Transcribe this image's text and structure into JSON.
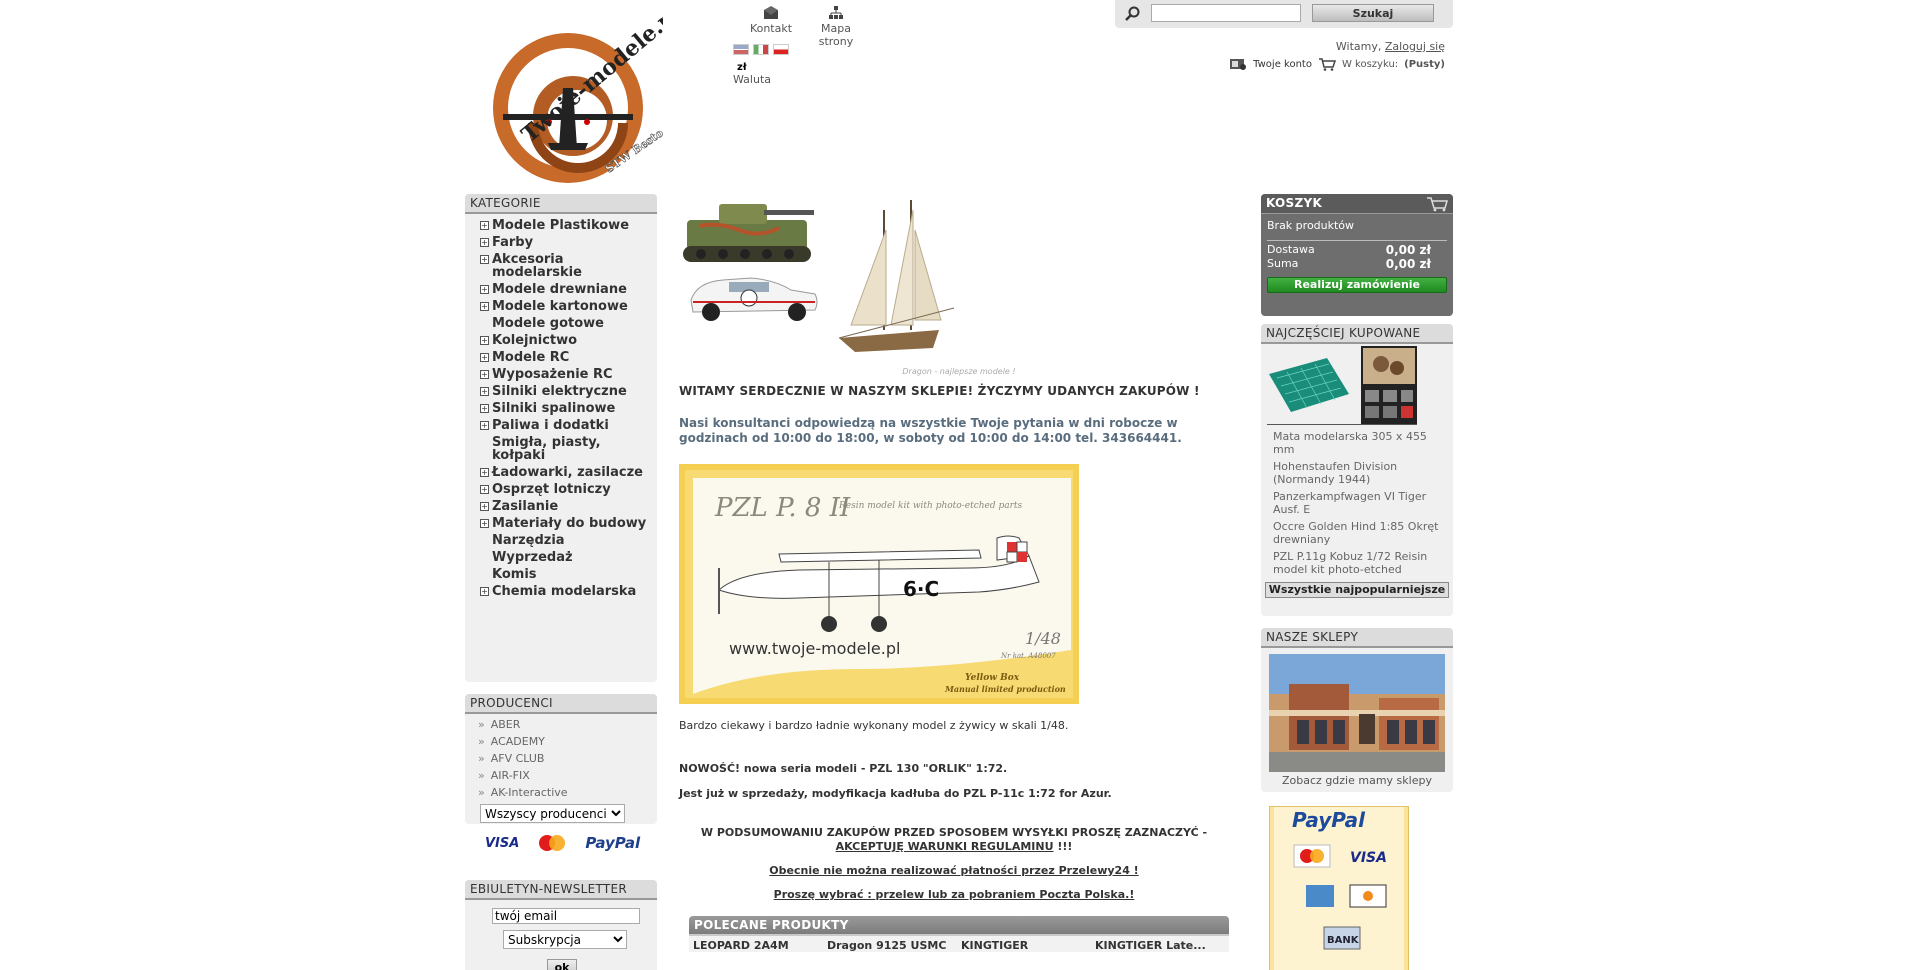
{
  "header": {
    "top_links": {
      "contact": "Kontakt",
      "sitemap": "Mapa strony"
    },
    "currency": {
      "symbol": "zł",
      "label": "Waluta"
    },
    "search": {
      "placeholder": "",
      "button": "Szukaj"
    },
    "welcome": {
      "text": "Witamy,",
      "login": "Zaloguj się"
    },
    "account": {
      "my_account": "Twoje konto",
      "cart_label": "W koszyku:",
      "cart_value": "(Pusty)"
    }
  },
  "categories": {
    "title": "KATEGORIE",
    "items": [
      {
        "label": "Modele Plastikowe",
        "expandable": true
      },
      {
        "label": "Farby",
        "expandable": true
      },
      {
        "label": "Akcesoria modelarskie",
        "expandable": true
      },
      {
        "label": "Modele drewniane",
        "expandable": true
      },
      {
        "label": "Modele kartonowe",
        "expandable": true
      },
      {
        "label": "Modele gotowe",
        "expandable": false
      },
      {
        "label": "Kolejnictwo",
        "expandable": true
      },
      {
        "label": "Modele RC",
        "expandable": true
      },
      {
        "label": "Wyposażenie RC",
        "expandable": true
      },
      {
        "label": "Silniki elektryczne",
        "expandable": true
      },
      {
        "label": "Silniki spalinowe",
        "expandable": true
      },
      {
        "label": "Paliwa i dodatki",
        "expandable": true
      },
      {
        "label": "Smigła, piasty, kołpaki",
        "expandable": false
      },
      {
        "label": "Ładowarki, zasilacze",
        "expandable": true
      },
      {
        "label": "Osprzęt lotniczy",
        "expandable": true
      },
      {
        "label": "Zasilanie",
        "expandable": true
      },
      {
        "label": "Materiały do budowy",
        "expandable": true
      },
      {
        "label": "Narzędzia",
        "expandable": false
      },
      {
        "label": "Wyprzedaż",
        "expandable": false
      },
      {
        "label": "Komis",
        "expandable": false
      },
      {
        "label": "Chemia modelarska",
        "expandable": true
      }
    ]
  },
  "producers": {
    "title": "PRODUCENCI",
    "items": [
      "ABER",
      "ACADEMY",
      "AFV CLUB",
      "AIR-FIX",
      "AK-Interactive"
    ],
    "select_value": "Wszyscy producenci"
  },
  "payment_logos": [
    "VISA",
    "MasterCard",
    "PayPal"
  ],
  "newsletter": {
    "title": "EBIULETYN-NEWSLETTER",
    "email_value": "twój email",
    "select_value": "Subskrypcja",
    "ok": "ok"
  },
  "center": {
    "banner_caption": "Dragon - najlepsze modele !",
    "welcome": "WITAMY SERDECZNIE W NASZYM SKLEPIE! ŻYCZYMY UDANYCH ZAKUPÓW !",
    "consultants": "Nasi konsultanci odpowiedzą na wszystkie Twoje pytania w dni robocze w godzinach od 10:00 do 18:00, w soboty od 10:00 do 14:00 tel. 343664441.",
    "kit": {
      "title": "PZL P. 8 II",
      "subtitle": "Resin model kit with photo-etched parts",
      "marking": "6·C",
      "url": "www.twoje-modele.pl",
      "scale": "1/48",
      "catalog": "Nr kat. A48007",
      "brand": "Yellow Box",
      "production": "Manual limited production"
    },
    "kit_description": "Bardzo ciekawy i bardzo ładnie wykonany model z żywicy w skali 1/48.",
    "news_1": "NOWOŚĆ!  nowa seria modeli  - PZL 130 \"ORLIK\"  1:72.",
    "news_2": "Jest już w sprzedaży, modyfikacja kadłuba do  PZL P-11c 1:72 for Azur.",
    "notice_1": "W PODSUMOWANIU ZAKUPÓW PRZED SPOSOBEM WYSYŁKI PROSZĘ ZAZNACZYĆ -",
    "notice_1b": "AKCEPTUJĘ WARUNKI REGULAMINU",
    "notice_1c": " !!!",
    "notice_2": "Obecnie nie można realizować płatności przez Przelewy24 !",
    "notice_3": "Proszę wybrać : przelew lub za pobraniem Poczta Polska.!",
    "recommended": {
      "title": "POLECANE PRODUKTY",
      "items": [
        "LEOPARD 2A4M",
        "Dragon 9125 USMC",
        "KINGTIGER",
        "KINGTIGER Late..."
      ]
    }
  },
  "cart": {
    "title": "KOSZYK",
    "empty": "Brak produktów",
    "shipping_label": "Dostawa",
    "shipping_value": "0,00 zł",
    "total_label": "Suma",
    "total_value": "0,00 zł",
    "checkout": "Realizuj zamówienie"
  },
  "bestsellers": {
    "title": "NAJCZĘŚCIEJ KUPOWANE",
    "items": [
      "Mata modelarska 305 x 455 mm",
      "Hohenstaufen Division (Normandy 1944)",
      "Panzerkampfwagen VI Tiger Ausf. E",
      "Occre Golden Hind 1:85 Okręt drewniany",
      "PZL P.11g Kobuz 1/72 Reisin model kit photo-etched"
    ],
    "all": "Wszystkie najpopularniejsze"
  },
  "stores": {
    "title": "NASZE SKLEPY",
    "caption": "Zobacz gdzie mamy sklepy"
  },
  "paypal_box": {
    "brand": "PayPal",
    "bank": "BANK"
  },
  "colors": {
    "box_header": "#8a8a8a",
    "cart_bg": "#6e6e6e",
    "checkout_green": "#2f9e2f",
    "consult_text": "#5a6d7e"
  }
}
